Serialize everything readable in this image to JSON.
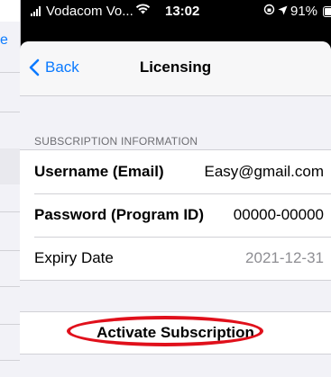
{
  "status_bar": {
    "carrier": "Vodacom Vo...",
    "time": "13:02",
    "battery": "91%",
    "battery_level": 0.91
  },
  "left_screen": {
    "partial_text": "e"
  },
  "nav": {
    "back_label": "Back",
    "title": "Licensing"
  },
  "section": {
    "header": "SUBSCRIPTION INFORMATION",
    "rows": [
      {
        "label": "Username (Email)",
        "value": "Easy@gmail.com"
      },
      {
        "label": "Password (Program ID)",
        "value": "00000-00000"
      },
      {
        "label": "Expiry Date",
        "value": "2021-12-31"
      }
    ]
  },
  "action": {
    "label": "Activate Subscription",
    "highlight_color": "#e0101b"
  },
  "colors": {
    "accent": "#0a7aff",
    "background": "#f2f2f7"
  }
}
